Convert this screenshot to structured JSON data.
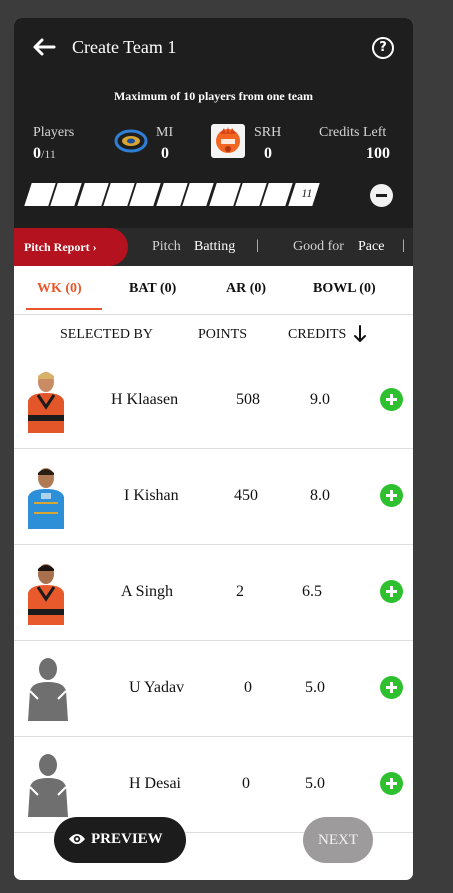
{
  "header": {
    "title": "Create Team 1",
    "max_note": "Maximum of 10 players from one team",
    "players_label": "Players",
    "players_count": "0",
    "players_total": "/11",
    "team1": {
      "name": "MI",
      "count": "0",
      "logo": "mi-logo"
    },
    "team2": {
      "name": "SRH",
      "count": "0",
      "logo": "srh-logo"
    },
    "credits_label": "Credits Left",
    "credits_value": "100",
    "slot_last": "11"
  },
  "infobar": {
    "pitch_report": "Pitch Report",
    "pitch_label": "Pitch",
    "pitch_value": "Batting",
    "separator": "|",
    "good_for_label": "Good for",
    "good_for_value": "Pace"
  },
  "tabs": [
    "WK (0)",
    "BAT (0)",
    "AR (0)",
    "BOWL (0)"
  ],
  "active_tab": "WK (0)",
  "sort": {
    "selected_by": "SELECTED BY",
    "points": "POINTS",
    "credits": "CREDITS"
  },
  "players": [
    {
      "name": "H Klaasen",
      "points": "508",
      "credits": "9.0",
      "avatar": "srh-player"
    },
    {
      "name": "I Kishan",
      "points": "450",
      "credits": "8.0",
      "avatar": "mi-player"
    },
    {
      "name": "A Singh",
      "points": "2",
      "credits": "6.5",
      "avatar": "srh-player"
    },
    {
      "name": "U Yadav",
      "points": "0",
      "credits": "5.0",
      "avatar": "placeholder"
    },
    {
      "name": "H Desai",
      "points": "0",
      "credits": "5.0",
      "avatar": "placeholder"
    }
  ],
  "footer": {
    "preview": "PREVIEW",
    "next": "NEXT"
  },
  "colors": {
    "header_bg": "#1e1e1e",
    "accent": "#e8562a",
    "pitch_red": "#b3121e",
    "add_green": "#2ec02f",
    "next_disabled": "#9d9b9b"
  }
}
